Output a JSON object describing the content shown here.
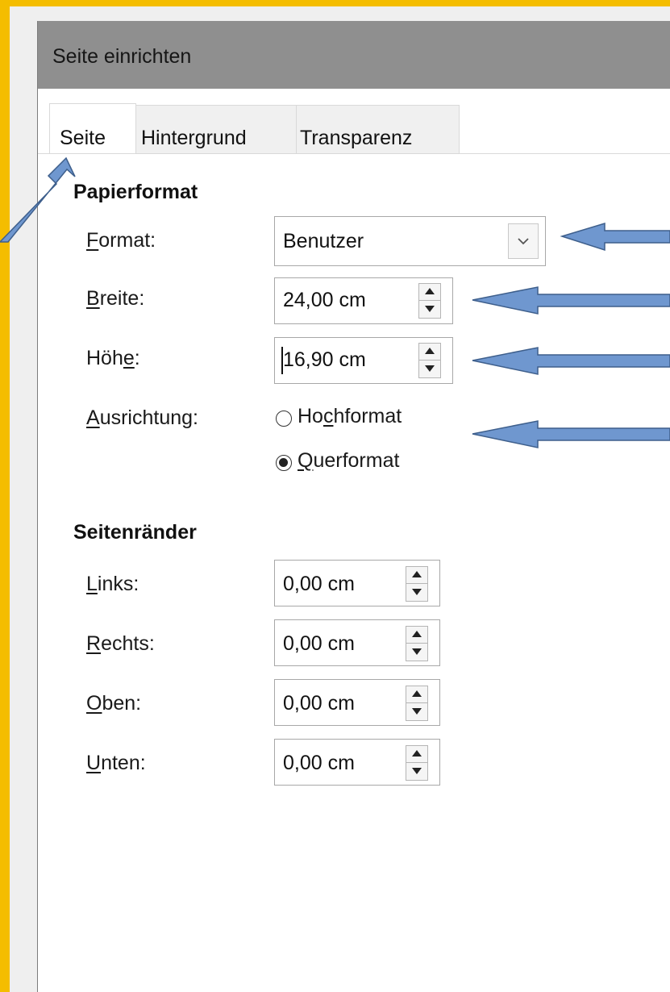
{
  "dialog": {
    "title": "Seite einrichten"
  },
  "tabs": [
    {
      "label": "Seite",
      "active": true
    },
    {
      "label": "Hintergrund",
      "active": false
    },
    {
      "label": "Transparenz",
      "active": false
    }
  ],
  "paper": {
    "heading": "Papierformat",
    "format_label_first": "F",
    "format_label_rest": "ormat:",
    "format_value": "Benutzer",
    "width_label_first": "B",
    "width_label_rest": "reite:",
    "width_value": "24,00 cm",
    "height_label_a": "Höh",
    "height_label_u": "e",
    "height_label_b": ":",
    "height_value": "16,90 cm",
    "orientation_label_first": "A",
    "orientation_label_rest": "usrichtung:",
    "portrait_a": "Ho",
    "portrait_u": "c",
    "portrait_b": "hformat",
    "landscape_u": "Q",
    "landscape_b": "uerformat",
    "selected_orientation": "Querformat"
  },
  "margins": {
    "heading": "Seitenränder",
    "left_first": "L",
    "left_rest": "inks:",
    "left_value": "0,00 cm",
    "right_first": "R",
    "right_rest": "echts:",
    "right_value": "0,00 cm",
    "top_first": "O",
    "top_rest": "ben:",
    "top_value": "0,00 cm",
    "bottom_first": "U",
    "bottom_rest": "nten:",
    "bottom_value": "0,00 cm"
  },
  "icons": [
    "chevron-down-icon",
    "spin-up-icon",
    "spin-down-icon",
    "radio-icon",
    "annotation-arrow"
  ],
  "colors": {
    "frame": "#f4bd00",
    "titlebar": "#8f8f8f",
    "arrow": "#6f97cf"
  }
}
